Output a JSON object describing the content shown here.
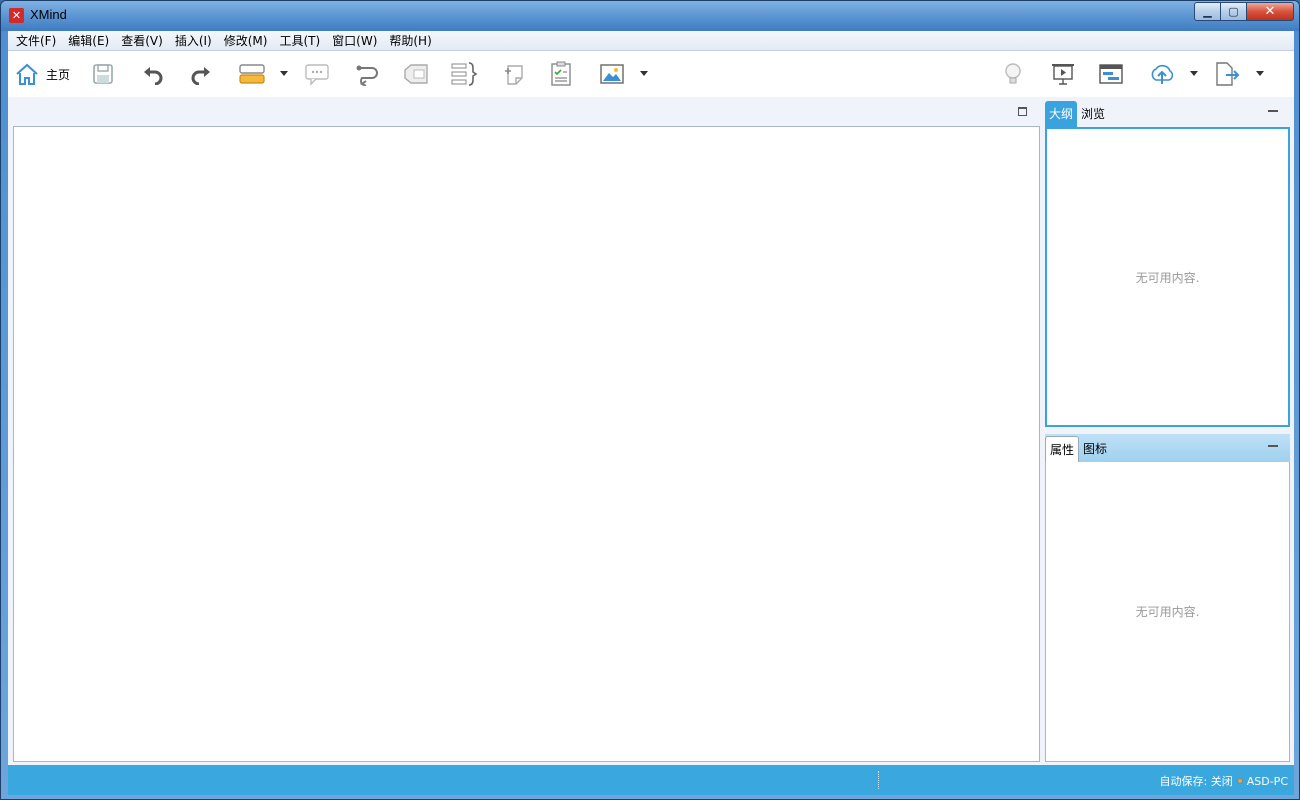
{
  "window": {
    "title": "XMind",
    "logo_glyph": "✕"
  },
  "window_controls": {
    "minimize": "▁",
    "maximize": "▢",
    "close": "✕"
  },
  "menu": [
    {
      "label": "文件(F)"
    },
    {
      "label": "编辑(E)"
    },
    {
      "label": "查看(V)"
    },
    {
      "label": "插入(I)"
    },
    {
      "label": "修改(M)"
    },
    {
      "label": "工具(T)"
    },
    {
      "label": "窗口(W)"
    },
    {
      "label": "帮助(H)"
    }
  ],
  "toolbar": {
    "home_label": "主页",
    "icons": [
      "home-icon",
      "save-icon",
      "undo-icon",
      "redo-icon",
      "topic-icon",
      "callout-icon",
      "relationship-icon",
      "boundary-icon",
      "summary-icon",
      "note-icon",
      "task-icon",
      "image-icon",
      "idea-icon",
      "presentation-icon",
      "gantt-icon",
      "upload-icon",
      "export-icon"
    ]
  },
  "outline_panel": {
    "tabs": [
      {
        "label": "大纲"
      },
      {
        "label": "浏览"
      }
    ],
    "empty_text": "无可用内容."
  },
  "properties_panel": {
    "tabs": [
      {
        "label": "属性"
      },
      {
        "label": "图标"
      }
    ],
    "empty_text": "无可用内容."
  },
  "status": {
    "autosave": "自动保存: 关闭",
    "user": "ASD-PC"
  },
  "colors": {
    "accent": "#3aa3de",
    "statusbar": "#3aa8df",
    "logo": "#d32a2a"
  }
}
